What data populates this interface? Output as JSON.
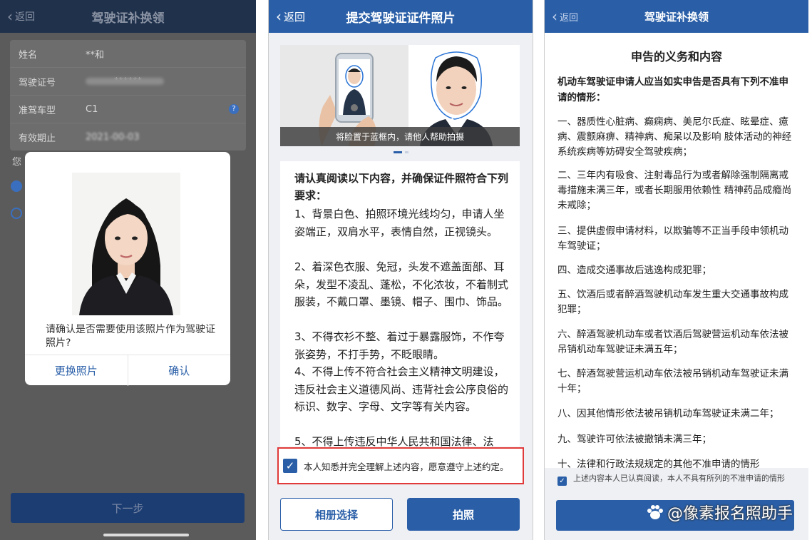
{
  "panel1": {
    "back_label": "返回",
    "title": "驾驶证补换领",
    "fields": [
      {
        "label": "姓名",
        "value": "**和"
      },
      {
        "label": "驾驶证号",
        "value": "******"
      },
      {
        "label": "准驾车型",
        "value": "C1"
      },
      {
        "label": "有效期止",
        "value": "2021-00-03"
      }
    ],
    "fragment_text": "您",
    "dialog": {
      "message": "请确认是否需要使用该照片作为驾驶证照片?",
      "change_button": "更换照片",
      "confirm_button": "确认"
    },
    "next_button": "下一步"
  },
  "panel2": {
    "back_label": "返回",
    "title": "提交驾驶证证件照片",
    "guide_caption": "将脸置于蓝框内，请他人帮助拍摄",
    "heading": "请认真阅读以下内容，并确保证件照符合下列要求：",
    "items": [
      "1、背景白色、拍照环境光线均匀，申请人坐姿端正，双肩水平，表情自然，正视镜头。",
      "2、着深色衣服、免冠，头发不遮盖面部、耳朵，发型不凌乱、蓬松，不化浓妆，不着制式服装，不戴口罩、墨镜、帽子、围巾、饰品。",
      "3、不得衣衫不整、着过于暴露服饰，不作夸张姿势，不打手势，不眨眼睛。",
      "4、不得上传不符合社会主义精神文明建设，违反社会主义道德风尚、违背社会公序良俗的标识、数字、字母、文字等有关内容。",
      "5、不得上传违反中华人民共和国法律、法"
    ],
    "agree_text": "本人知悉并完全理解上述内容，愿意遵守上述约定。",
    "album_button": "相册选择",
    "shoot_button": "拍照"
  },
  "panel3": {
    "back_label": "返回",
    "title": "驾驶证补换领",
    "section_title": "申告的义务和内容",
    "lead": "机动车驾驶证申请人应当如实申告是否具有下列不准申请的情形：",
    "items": [
      "一、器质性心脏病、癫痫病、美尼尔氏症、眩晕症、癔病、震颤麻痹、精神病、痴呆以及影响 肢体活动的神经系统疾病等妨碍安全驾驶疾病；",
      "二、三年内有吸食、注射毒品行为或者解除强制隔离戒毒措施未满三年，或者长期服用依赖性 精神药品成瘾尚未戒除；",
      "三、提供虚假申请材料，以欺骗等不正当手段申领机动车驾驶证；",
      "四、造成交通事故后逃逸构成犯罪；",
      "五、饮酒后或者醉酒驾驶机动车发生重大交通事故构成犯罪；",
      "六、醉酒驾驶机动车或者饮酒后驾驶营运机动车依法被吊销机动车驾驶证未满五年；",
      "七、醉酒驾驶营运机动车依法被吊销机动车驾驶证未满十年；",
      "八、因其他情形依法被吊销机动车驾驶证未满二年；",
      "九、驾驶许可依法被撤销未满三年；",
      "十、法律和行政法规规定的其他不准申请的情形"
    ],
    "footer_text": "上述内容本人已认真阅读，本人不具有所列的不准申请的情形",
    "watermark": "@像素报名照助手"
  }
}
